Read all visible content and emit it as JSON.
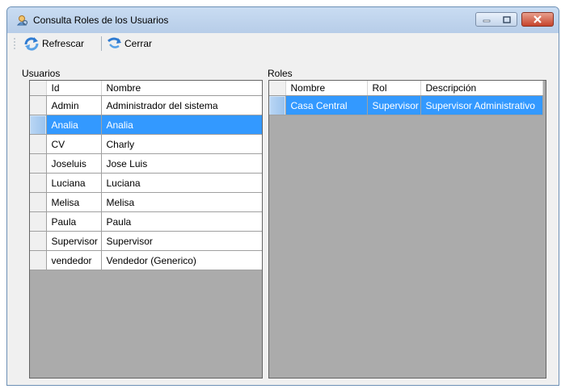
{
  "window": {
    "title": "Consulta Roles de los Usuarios"
  },
  "toolbar": {
    "refresh_label": "Refrescar",
    "close_label": "Cerrar"
  },
  "usuarios": {
    "label": "Usuarios",
    "columns": [
      "Id",
      "Nombre"
    ],
    "rows": [
      [
        "Admin",
        "Administrador del sistema"
      ],
      [
        "Analia",
        "Analia"
      ],
      [
        "CV",
        "Charly"
      ],
      [
        "Joseluis",
        "Jose Luis"
      ],
      [
        "Luciana",
        "Luciana"
      ],
      [
        "Melisa",
        "Melisa"
      ],
      [
        "Paula",
        "Paula"
      ],
      [
        "Supervisor",
        "Supervisor"
      ],
      [
        "vendedor",
        "Vendedor (Generico)"
      ]
    ],
    "selected_row": 1
  },
  "roles": {
    "label": "Roles",
    "columns": [
      "Nombre",
      "Rol",
      "Descripción"
    ],
    "rows": [
      [
        "Casa Central",
        "Supervisor",
        "Supervisor Administrativo"
      ]
    ],
    "selected_row": 0
  },
  "colors": {
    "selection": "#3399ff",
    "grid_background": "#ababab",
    "window_background": "#f0f0f0"
  },
  "icons": {
    "title": "user-search-icon",
    "refresh": "refresh-arrows-icon",
    "close": "close-arrow-icon"
  }
}
